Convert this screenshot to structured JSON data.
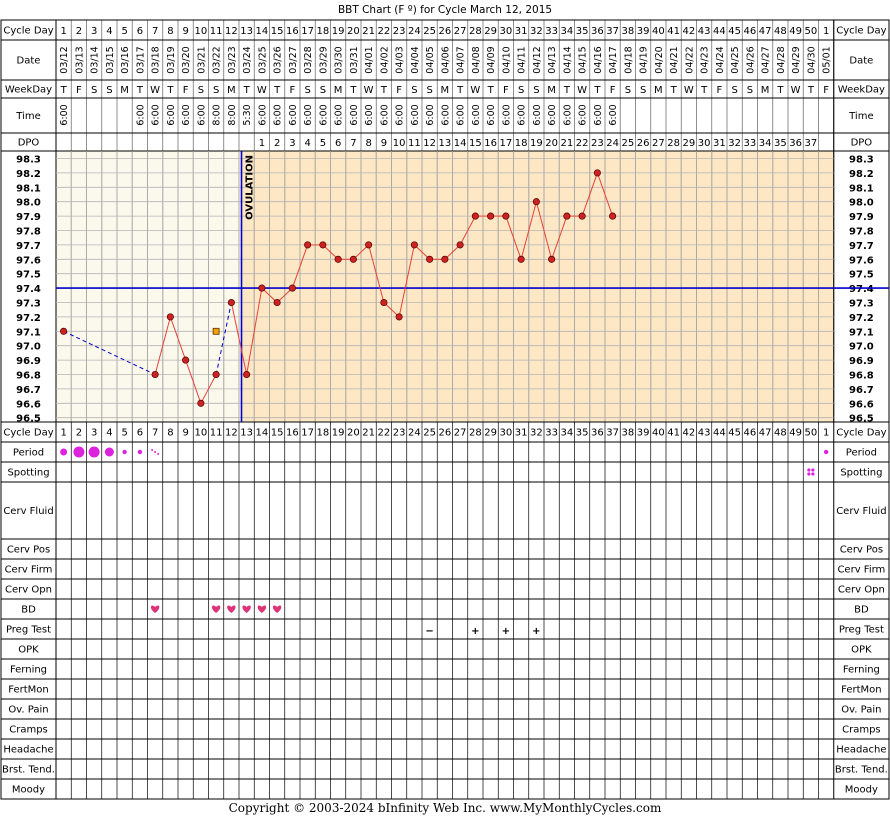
{
  "title": "BBT Chart (F º) for Cycle March 12, 2015",
  "copyright": "Copyright © 2003-2024 bInfinity Web Inc.     www.MyMonthlyCycles.com",
  "colors": {
    "follicular_bg": "#fbf8ec",
    "luteal_bg": "#fde7c4",
    "grid": "#b4b4b4",
    "temp_line": "#e8423a",
    "temp_marker": "#cc2222",
    "coverline": "#0000cc",
    "period": "#dd22dd",
    "bd": "#dd3377",
    "preg_test": "#6633cc"
  },
  "row_labels": {
    "cycle_day": "Cycle Day",
    "date": "Date",
    "weekday": "WeekDay",
    "time": "Time",
    "dpo": "DPO",
    "period": "Period",
    "spotting": "Spotting",
    "cerv_fluid": "Cerv Fluid",
    "cerv_pos": "Cerv Pos",
    "cerv_firm": "Cerv Firm",
    "cerv_opn": "Cerv Opn",
    "bd": "BD",
    "preg_test": "Preg Test",
    "opk": "OPK",
    "ferning": "Ferning",
    "fertmon": "FertMon",
    "ov_pain": "Ov. Pain",
    "cramps": "Cramps",
    "headache": "Headache",
    "brst_tend": "Brst. Tend.",
    "moody": "Moody"
  },
  "ovulation_label": "OVULATION",
  "cycle_days": [
    "1",
    "2",
    "3",
    "4",
    "5",
    "6",
    "7",
    "8",
    "9",
    "10",
    "11",
    "12",
    "13",
    "14",
    "15",
    "16",
    "17",
    "18",
    "19",
    "20",
    "21",
    "22",
    "23",
    "24",
    "25",
    "26",
    "27",
    "28",
    "29",
    "30",
    "31",
    "32",
    "33",
    "34",
    "35",
    "36",
    "37",
    "38",
    "39",
    "40",
    "41",
    "42",
    "43",
    "44",
    "45",
    "46",
    "47",
    "48",
    "49",
    "50",
    "1"
  ],
  "dates": [
    "03/12",
    "03/13",
    "03/14",
    "03/15",
    "03/16",
    "03/17",
    "03/18",
    "03/19",
    "03/20",
    "03/21",
    "03/22",
    "03/23",
    "03/24",
    "03/25",
    "03/26",
    "03/27",
    "03/28",
    "03/29",
    "03/30",
    "03/31",
    "04/01",
    "04/02",
    "04/03",
    "04/04",
    "04/05",
    "04/06",
    "04/07",
    "04/08",
    "04/09",
    "04/10",
    "04/11",
    "04/12",
    "04/13",
    "04/14",
    "04/15",
    "04/16",
    "04/17",
    "04/18",
    "04/19",
    "04/20",
    "04/21",
    "04/22",
    "04/23",
    "04/24",
    "04/25",
    "04/26",
    "04/27",
    "04/28",
    "04/29",
    "04/30",
    "05/01"
  ],
  "weekdays": [
    "T",
    "F",
    "S",
    "S",
    "M",
    "T",
    "W",
    "T",
    "F",
    "S",
    "S",
    "M",
    "T",
    "W",
    "T",
    "F",
    "S",
    "S",
    "M",
    "T",
    "W",
    "T",
    "F",
    "S",
    "S",
    "M",
    "T",
    "W",
    "T",
    "F",
    "S",
    "S",
    "M",
    "T",
    "W",
    "T",
    "F",
    "S",
    "S",
    "M",
    "T",
    "W",
    "T",
    "F",
    "S",
    "S",
    "M",
    "T",
    "W",
    "T",
    "F"
  ],
  "times": [
    "6:00",
    "",
    "",
    "",
    "",
    "6:00",
    "6:00",
    "6:00",
    "6:00",
    "6:00",
    "8:00",
    "8:00",
    "5:30",
    "6:00",
    "6:00",
    "6:00",
    "6:00",
    "6:00",
    "6:00",
    "6:00",
    "6:00",
    "6:00",
    "6:00",
    "6:00",
    "6:00",
    "6:00",
    "6:00",
    "6:00",
    "6:00",
    "6:00",
    "6:00",
    "6:00",
    "6:00",
    "6:00",
    "6:00",
    "6:00",
    "6:00",
    "",
    "",
    "",
    "",
    "",
    "",
    "",
    "",
    "",
    "",
    "",
    "",
    "",
    ""
  ],
  "dpo": [
    "",
    "",
    "",
    "",
    "",
    "",
    "",
    "",
    "",
    "",
    "",
    "",
    "",
    "1",
    "2",
    "3",
    "4",
    "5",
    "6",
    "7",
    "8",
    "9",
    "10",
    "11",
    "12",
    "13",
    "14",
    "15",
    "16",
    "17",
    "18",
    "19",
    "20",
    "21",
    "22",
    "23",
    "24",
    "25",
    "26",
    "27",
    "28",
    "29",
    "30",
    "31",
    "32",
    "33",
    "34",
    "35",
    "36",
    "37",
    ""
  ],
  "temp_axis": [
    "98.3",
    "98.2",
    "98.1",
    "98.0",
    "97.9",
    "97.8",
    "97.7",
    "97.6",
    "97.5",
    "97.4",
    "97.3",
    "97.2",
    "97.1",
    "97.0",
    "96.9",
    "96.8",
    "96.7",
    "96.6",
    "96.5"
  ],
  "chart_data": {
    "type": "line",
    "title": "BBT Chart (F º) for Cycle March 12, 2015",
    "xlabel": "Cycle Day",
    "ylabel": "",
    "ylim": [
      96.5,
      98.3
    ],
    "grid": true,
    "x": [
      1,
      7,
      8,
      9,
      10,
      12,
      13,
      14,
      15,
      16,
      17,
      18,
      19,
      20,
      21,
      22,
      23,
      24,
      25,
      26,
      27,
      28,
      29,
      30,
      31,
      32,
      33,
      34,
      35,
      36,
      37
    ],
    "series": [
      {
        "values": [
          97.1,
          96.8,
          97.2,
          96.9,
          96.6,
          96.8,
          97.3,
          96.8,
          97.4,
          97.3,
          97.4,
          97.7,
          97.7,
          97.6,
          97.6,
          97.7,
          97.3,
          97.2,
          97.7,
          97.6,
          97.6,
          97.7,
          97.9,
          97.9,
          97.9,
          97.6,
          98.0,
          97.6,
          97.9,
          97.9,
          98.2,
          97.9
        ]
      }
    ],
    "points": [
      {
        "day": 1,
        "temp": 97.1
      },
      {
        "day": 7,
        "temp": 96.8
      },
      {
        "day": 8,
        "temp": 97.2
      },
      {
        "day": 9,
        "temp": 96.9
      },
      {
        "day": 10,
        "temp": 96.6
      },
      {
        "day": 11,
        "temp": 96.8
      },
      {
        "day": 12,
        "temp": 97.3
      },
      {
        "day": 13,
        "temp": 96.8
      },
      {
        "day": 14,
        "temp": 97.4
      },
      {
        "day": 15,
        "temp": 97.3
      },
      {
        "day": 16,
        "temp": 97.4
      },
      {
        "day": 17,
        "temp": 97.7
      },
      {
        "day": 18,
        "temp": 97.7
      },
      {
        "day": 19,
        "temp": 97.6
      },
      {
        "day": 20,
        "temp": 97.6
      },
      {
        "day": 21,
        "temp": 97.7
      },
      {
        "day": 22,
        "temp": 97.3
      },
      {
        "day": 23,
        "temp": 97.2
      },
      {
        "day": 24,
        "temp": 97.7
      },
      {
        "day": 25,
        "temp": 97.6
      },
      {
        "day": 26,
        "temp": 97.6
      },
      {
        "day": 27,
        "temp": 97.7
      },
      {
        "day": 28,
        "temp": 97.9
      },
      {
        "day": 29,
        "temp": 97.9
      },
      {
        "day": 30,
        "temp": 97.9
      },
      {
        "day": 31,
        "temp": 97.6
      },
      {
        "day": 32,
        "temp": 98.0
      },
      {
        "day": 33,
        "temp": 97.6
      },
      {
        "day": 34,
        "temp": 97.9
      },
      {
        "day": 35,
        "temp": 97.9
      },
      {
        "day": 36,
        "temp": 98.2
      },
      {
        "day": 37,
        "temp": 97.9
      }
    ],
    "discarded_points": [
      {
        "day": 11,
        "temp": 97.1
      }
    ],
    "coverline": 97.4,
    "ovulation_day": 13
  },
  "period": [
    {
      "day": 1,
      "level": "light"
    },
    {
      "day": 2,
      "level": "heavy"
    },
    {
      "day": 3,
      "level": "heavy"
    },
    {
      "day": 4,
      "level": "medium"
    },
    {
      "day": 5,
      "level": "spot"
    },
    {
      "day": 6,
      "level": "spot"
    },
    {
      "day": 7,
      "level": "dots"
    },
    {
      "day": 51,
      "level": "spot"
    }
  ],
  "spotting_days": [
    50
  ],
  "bd_days": [
    7,
    11,
    12,
    13,
    14,
    15
  ],
  "preg_tests": [
    {
      "day": 25,
      "symbol": "−"
    },
    {
      "day": 28,
      "symbol": "+"
    },
    {
      "day": 30,
      "symbol": "+"
    },
    {
      "day": 32,
      "symbol": "+"
    }
  ]
}
